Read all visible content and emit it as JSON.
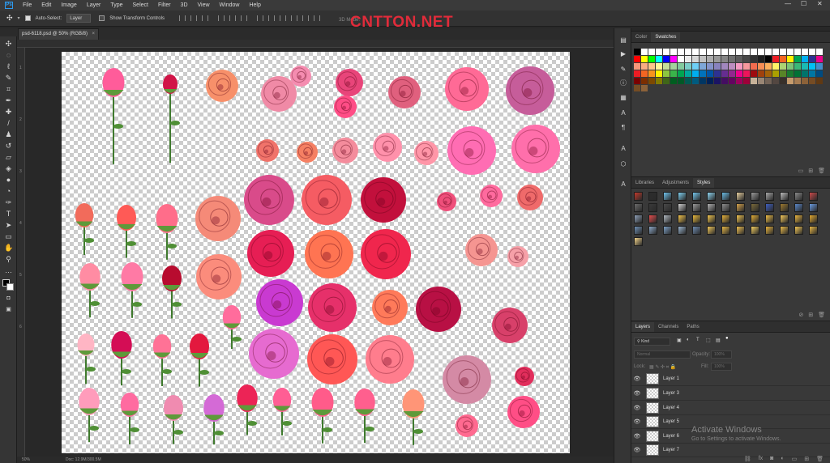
{
  "app": {
    "logo_text": "Ps"
  },
  "menubar": {
    "items": [
      "File",
      "Edit",
      "Image",
      "Layer",
      "Type",
      "Select",
      "Filter",
      "3D",
      "View",
      "Window",
      "Help"
    ],
    "minimize": "—",
    "maximize": "☐",
    "close": "✕"
  },
  "options": {
    "auto_select_label": "Auto-Select:",
    "auto_select_value": "Layer",
    "transform_label": "Show Transform Controls",
    "mode_3d_label": "3D Mode:",
    "watermark": "CNTTON.NET"
  },
  "document": {
    "tab_title": "psd-6118.psd @ 50% (RGB/8)",
    "zoom": "50%",
    "doc_size": "Doc: 12.9M/300.5M"
  },
  "ruler_left": [
    "1",
    "2",
    "3",
    "4",
    "5",
    "6"
  ],
  "tools": [
    "move-tool",
    "marquee-tool",
    "lasso-tool",
    "quick-select-tool",
    "crop-tool",
    "eyedropper-tool",
    "healing-tool",
    "brush-tool",
    "stamp-tool",
    "history-brush-tool",
    "eraser-tool",
    "gradient-tool",
    "blur-tool",
    "dodge-tool",
    "pen-tool",
    "type-tool",
    "path-select-tool",
    "shape-tool",
    "hand-tool",
    "zoom-tool"
  ],
  "color_panel": {
    "tabs": [
      "Color",
      "Swatches"
    ],
    "active": "Swatches"
  },
  "swatches": {
    "top_row": [
      "#000000",
      "#ffffff",
      "#ffffff",
      "#ffffff",
      "#ffffff",
      "#ffffff",
      "#ffffff",
      "#ffffff",
      "#ffffff",
      "#ffffff",
      "#ffffff",
      "#ffffff",
      "#ffffff",
      "#ffffff",
      "#ffffff",
      "#ffffff",
      "#ffffff",
      "#ffffff",
      "#ffffff",
      "#ffffff",
      "#ffffff",
      "#ffffff",
      "#ffffff",
      "#ffffff",
      "#ffffff",
      "#ffffff"
    ],
    "rows": [
      [
        "#ff0000",
        "#ffff00",
        "#00ff00",
        "#00ffff",
        "#0000ff",
        "#ff00ff",
        "#ffffff",
        "#ebebeb",
        "#d6d6d6",
        "#c2c2c2",
        "#adadad",
        "#999999",
        "#858585",
        "#707070",
        "#5c5c5c",
        "#474747",
        "#333333",
        "#1f1f1f",
        "#000000",
        "#ed1c24",
        "#f26522",
        "#fff200",
        "#00a651",
        "#00aeef",
        "#2e3192",
        "#ec008c"
      ],
      [
        "#f7977a",
        "#f9ad81",
        "#fdc68a",
        "#fff79a",
        "#c4df9b",
        "#a3d39c",
        "#82ca9d",
        "#7bcdc8",
        "#6ecff6",
        "#7ea7d8",
        "#8493ca",
        "#8882be",
        "#a187be",
        "#bc8dbf",
        "#f49ac2",
        "#f6989d",
        "#f26c4f",
        "#f68e55",
        "#fbaf5c",
        "#fff467",
        "#acd372",
        "#7cc576",
        "#3bb878",
        "#1abbb4",
        "#00bff3",
        "#438ccb"
      ],
      [
        "#ed1c24",
        "#f26522",
        "#f7941d",
        "#fff200",
        "#8dc73f",
        "#39b54a",
        "#00a651",
        "#00a99d",
        "#00aeef",
        "#0072bc",
        "#0054a6",
        "#2e3192",
        "#662d91",
        "#92278f",
        "#ec008c",
        "#ed145b",
        "#9e0b0f",
        "#a0410d",
        "#a3620a",
        "#aba000",
        "#598527",
        "#197b30",
        "#007236",
        "#00746b",
        "#0076a3",
        "#004b80"
      ],
      [
        "#790000",
        "#7b2e00",
        "#7d4900",
        "#827b00",
        "#406618",
        "#005e20",
        "#005826",
        "#005952",
        "#005b7f",
        "#003663",
        "#002157",
        "#1b1464",
        "#440e62",
        "#630460",
        "#9e005d",
        "#9e0039",
        "#c7b299",
        "#998675",
        "#736357",
        "#534741",
        "#37302a",
        "#c69c6d",
        "#a67c52",
        "#8c6239",
        "#754c24",
        "#603913"
      ],
      [
        "#754c24",
        "#8c6239"
      ]
    ]
  },
  "styles_panel": {
    "tabs": [
      "Libraries",
      "Adjustments",
      "Styles"
    ],
    "active": "Styles"
  },
  "styles": [
    "#c0392b",
    "#2d2d2d",
    "#6fc3ee",
    "#7fd0f0",
    "#74c6ed",
    "#8fd6f2",
    "#6abbe4",
    "#e8d0a0",
    "#9b9b9b",
    "#a8a8a8",
    "#bdbdbd",
    "#8a8a8a",
    "#c94a4a",
    "#6b6b6b",
    "#3a3a3a",
    "#4a4a4a",
    "#cfcfcf",
    "#999999",
    "#b0b0b0",
    "#8e8e8e",
    "#d4a24c",
    "#7b6a3a",
    "#3f5fbf",
    "#9d7a2f",
    "#5a86c7",
    "#6a9be0",
    "#8ea0b8",
    "#e44d4d",
    "#b0b8c0",
    "#f3c34a",
    "#e9b93c",
    "#f1c54e",
    "#e6b13a",
    "#f0c350",
    "#e4ae36",
    "#edbd46",
    "#f5c95a",
    "#eab640",
    "#e2a830",
    "#6e8fb4",
    "#8ca8c8",
    "#7da0c4",
    "#9bb5d0",
    "#6d8bb0",
    "#f2c85a",
    "#e8b846",
    "#efc052",
    "#f6cf60",
    "#e5b23e",
    "#ebbb4a",
    "#f1c656",
    "#e9b744",
    "#f3d48a"
  ],
  "layers_panel": {
    "tabs": [
      "Layers",
      "Channels",
      "Paths"
    ],
    "active": "Layers",
    "filter_label": "Kind",
    "blend_mode": "Normal",
    "opacity_label": "Opacity:",
    "opacity_value": "100%",
    "lock_label": "Lock:",
    "fill_label": "Fill:",
    "fill_value": "100%",
    "layers": [
      "Layer 1",
      "Layer 3",
      "Layer 4",
      "Layer 5",
      "Layer 6",
      "Layer 7"
    ]
  },
  "system": {
    "activate_title": "Activate Windows",
    "activate_sub": "Go to Settings to activate Windows."
  }
}
